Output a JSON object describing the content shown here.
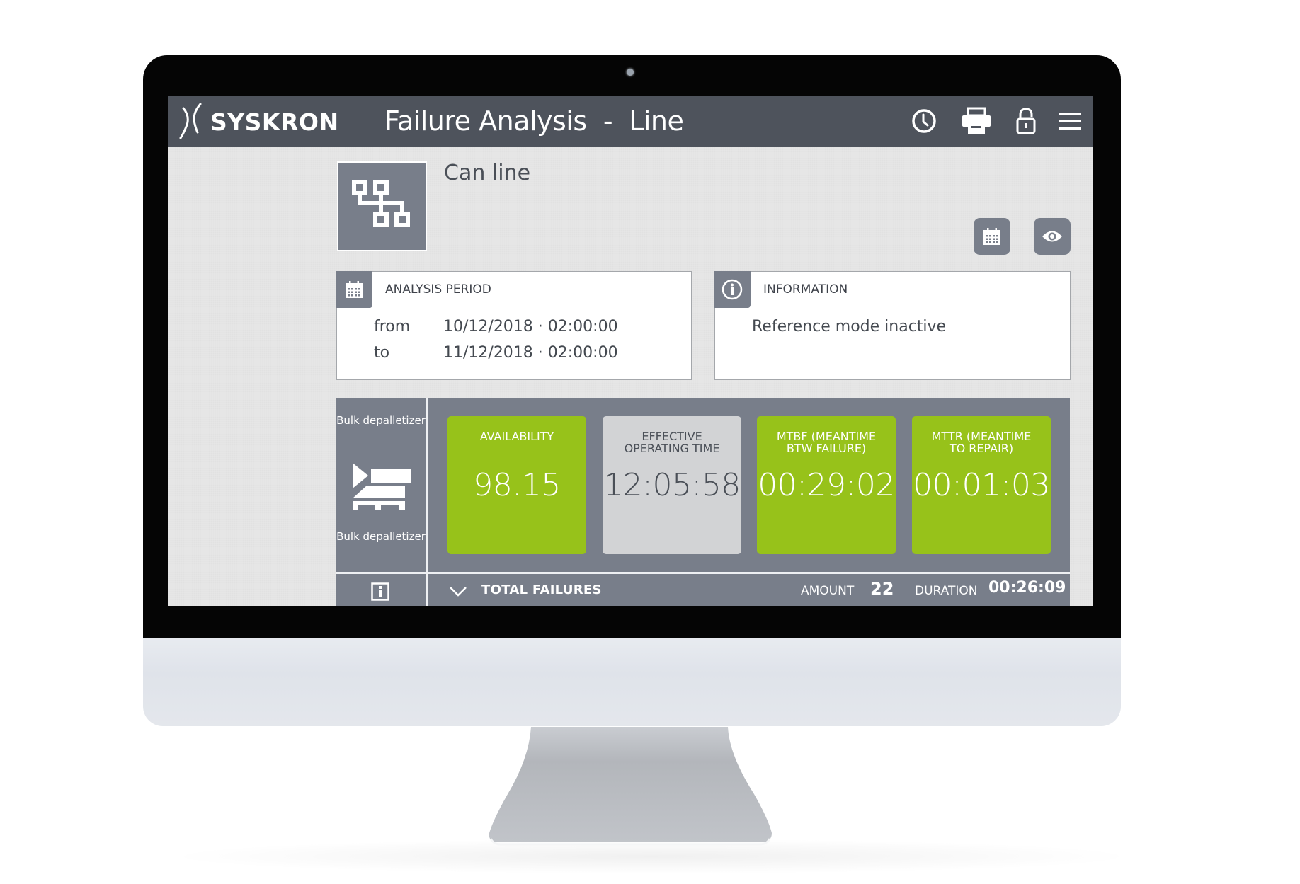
{
  "header": {
    "brand": "SYSKRON",
    "title": "Failure Analysis  -  Line",
    "icons": [
      "clock-icon",
      "printer-icon",
      "unlock-icon",
      "menu-icon"
    ]
  },
  "line": {
    "name": "Can line",
    "tile_icon": "network-hierarchy-icon",
    "buttons": [
      "calendar-icon",
      "eye-icon"
    ]
  },
  "analysis_period": {
    "title": "ANALYSIS PERIOD",
    "from_label": "from",
    "from_value": "10/12/2018 · 02:00:00",
    "to_label": "to",
    "to_value": "11/12/2018 · 02:00:00"
  },
  "information": {
    "title": "INFORMATION",
    "text": "Reference mode inactive"
  },
  "machine": {
    "name_top": "Bulk depalletizer",
    "name_bottom": "Bulk depalletizer",
    "icon": "depalletizer-icon"
  },
  "kpis": [
    {
      "label": "AVAILABILITY",
      "value": "98.15",
      "status": "good",
      "color": "#97c21a"
    },
    {
      "label": "EFFECTIVE OPERATING TIME",
      "value": "12:05:58",
      "status": "neutral",
      "color": "#d2d3d5"
    },
    {
      "label": "MTBF (MEANTIME BTW FAILURE)",
      "value": "00:29:02",
      "status": "good",
      "color": "#97c21a"
    },
    {
      "label": "MTTR (MEANTIME TO REPAIR)",
      "value": "00:01:03",
      "status": "good",
      "color": "#97c21a"
    }
  ],
  "failures": {
    "label": "TOTAL FAILURES",
    "amount_label": "AMOUNT",
    "amount_value": "22",
    "duration_label": "DURATION",
    "duration_value": "00:26:09"
  },
  "colors": {
    "header_bg": "#4e535c",
    "panel_bg": "#787e8a",
    "accent_green": "#97c21a"
  }
}
